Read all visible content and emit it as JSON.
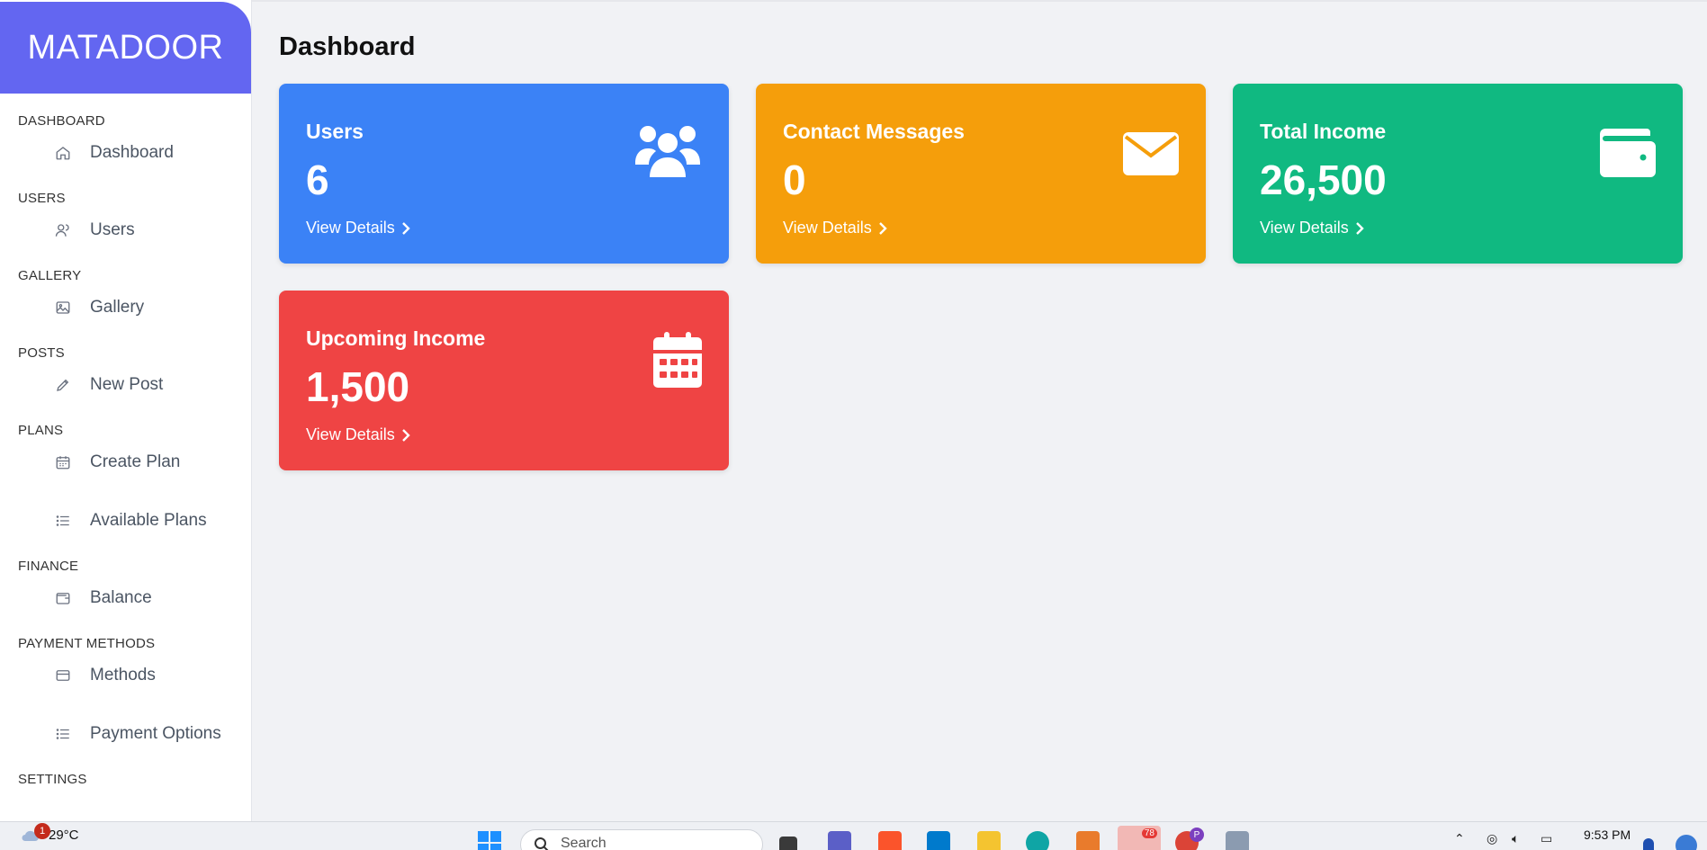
{
  "brand": "MATADOOR",
  "sidebar": {
    "sections": [
      {
        "title": "DASHBOARD",
        "items": [
          {
            "label": "Dashboard",
            "icon": "home-icon"
          }
        ]
      },
      {
        "title": "USERS",
        "items": [
          {
            "label": "Users",
            "icon": "user-icon"
          }
        ]
      },
      {
        "title": "GALLERY",
        "items": [
          {
            "label": "Gallery",
            "icon": "image-icon"
          }
        ]
      },
      {
        "title": "POSTS",
        "items": [
          {
            "label": "New Post",
            "icon": "pencil-icon"
          }
        ]
      },
      {
        "title": "PLANS",
        "items": [
          {
            "label": "Create Plan",
            "icon": "calendar-icon"
          },
          {
            "label": "Available Plans",
            "icon": "list-icon"
          }
        ]
      },
      {
        "title": "FINANCE",
        "items": [
          {
            "label": "Balance",
            "icon": "wallet-icon"
          }
        ]
      },
      {
        "title": "PAYMENT METHODS",
        "items": [
          {
            "label": "Methods",
            "icon": "credit-card-icon"
          },
          {
            "label": "Payment Options",
            "icon": "list-icon"
          }
        ]
      },
      {
        "title": "SETTINGS",
        "items": []
      }
    ]
  },
  "main": {
    "title": "Dashboard",
    "cards": [
      {
        "label": "Users",
        "value": "6",
        "link": "View Details",
        "color": "#3b82f6",
        "icon": "users-icon"
      },
      {
        "label": "Contact Messages",
        "value": "0",
        "link": "View Details",
        "color": "#f59e0b",
        "icon": "envelope-icon"
      },
      {
        "label": "Total Income",
        "value": "26,500",
        "link": "View Details",
        "color": "#10b981",
        "icon": "wallet-icon"
      },
      {
        "label": "Upcoming Income",
        "value": "1,500",
        "link": "View Details",
        "color": "#ef4444",
        "icon": "calendar-icon"
      }
    ]
  },
  "taskbar": {
    "weather": "29°C",
    "weather_badge": "1",
    "search_placeholder": "Search",
    "mail_badge": "78",
    "profile_badge": "P",
    "clock": "9:53 PM"
  }
}
